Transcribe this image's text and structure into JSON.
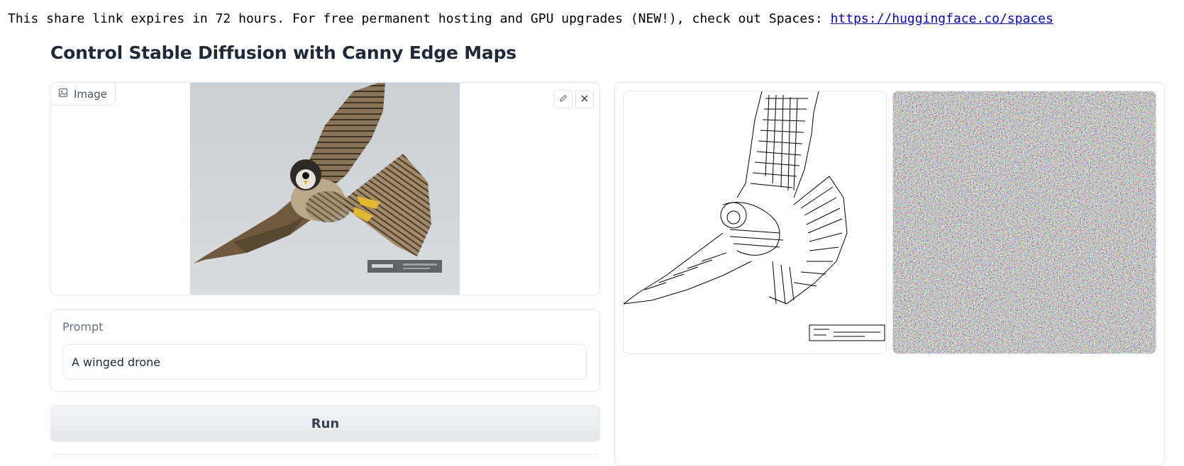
{
  "banner": {
    "text": "This share link expires in 72 hours. For free permanent hosting and GPU upgrades (NEW!), check out Spaces: ",
    "link_text": "https://huggingface.co/spaces"
  },
  "page": {
    "title": "Control Stable Diffusion with Canny Edge Maps"
  },
  "input_image": {
    "label": "Image",
    "icon": "image-icon",
    "tools": [
      "pencil-icon",
      "close-icon"
    ]
  },
  "prompt": {
    "label": "Prompt",
    "value": "A winged drone"
  },
  "run_button": {
    "label": "Run"
  },
  "gallery": {
    "items": [
      "canny-edge-map",
      "generated-noise-image"
    ]
  },
  "colors": {
    "border": "#e5e7eb",
    "link": "#0000ee",
    "button_bg": "#e5e7eb"
  }
}
